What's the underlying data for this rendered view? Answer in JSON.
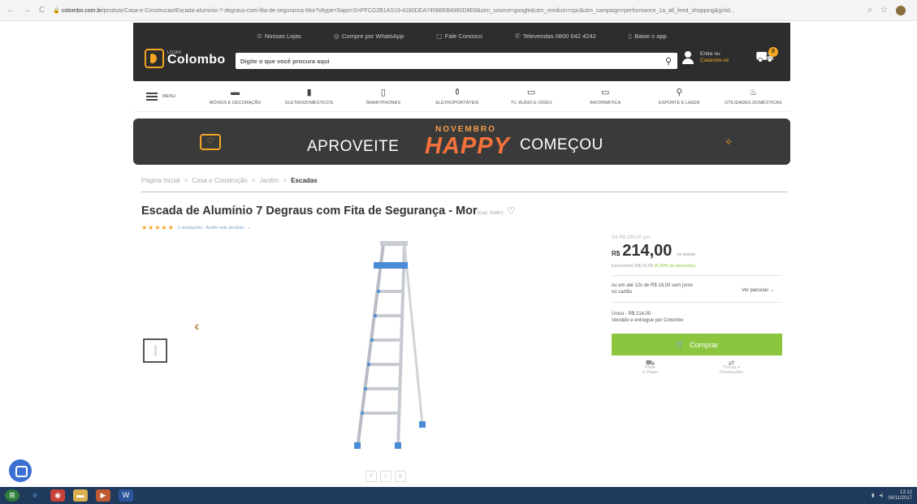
{
  "browser": {
    "url_host": "colombo.com.br",
    "url_path": "/produto/Casa-e-Construcao/Escada-aluminio-7-degraus-com-fita-de-seguranca-Mor?sltype=Sapo=S=PFCG2B1AS19-4180DEA74588EB4980D8E8&utm_source=google&utm_medium=cpc&utm_campaign=performance_1a_all_feed_shopping&gclid..."
  },
  "header": {
    "links": [
      {
        "icon": "pin-icon",
        "label": "Nossas Lojas"
      },
      {
        "icon": "whatsapp-icon",
        "label": "Compre por WhatsApp"
      },
      {
        "icon": "chat-icon",
        "label": "Fale Conosco"
      },
      {
        "icon": "phone-icon",
        "label": "Televendas 0800 642 4242"
      },
      {
        "icon": "mobile-icon",
        "label": "Baixe o app"
      }
    ],
    "logo_small": "LOJAS",
    "logo": "Colombo",
    "search_placeholder": "Digite o que você procura aqui",
    "login_line1": "Entre ou",
    "login_line2": "Cadastre-se",
    "cart_count": "0"
  },
  "nav": {
    "menu_label": "MENU",
    "categories": [
      {
        "icon": "sofa-icon",
        "label": "MÓVEIS E DECORAÇÃO"
      },
      {
        "icon": "fridge-icon",
        "label": "ELETRODOMÉSTICOS"
      },
      {
        "icon": "smartphone-icon",
        "label": "SMARTPHONES"
      },
      {
        "icon": "blender-icon",
        "label": "ELETROPORTÁTEIS"
      },
      {
        "icon": "tv-icon",
        "label": "TV, ÁUDIO E VÍDEO"
      },
      {
        "icon": "laptop-icon",
        "label": "INFORMÁTICA"
      },
      {
        "icon": "bike-icon",
        "label": "ESPORTE E LAZER"
      },
      {
        "icon": "pot-icon",
        "label": "UTILIDADES DOMÉSTICAS"
      }
    ]
  },
  "banner": {
    "left": "APROVEITE",
    "month": "NOVEMBRO",
    "happy": "HAPPY",
    "right": "COMEÇOU"
  },
  "breadcrumb": [
    "Página Inicial",
    "Casa e Construção",
    "Jardim",
    "Escadas"
  ],
  "product": {
    "title": "Escada de Alumínio 7 Degraus com Fita de Segurança - Mor",
    "code": "(Cod. 22487)",
    "reviews": "2 avaliações",
    "review_link": "Avalie este produto",
    "rating": 5
  },
  "buybox": {
    "from_price": "De R$ 299,00 por",
    "currency": "R$",
    "price": "214,00",
    "price_note": "no boleto",
    "economy_prefix": "Economize R$ 15,00",
    "economy_pct": "(5,00% de desconto)",
    "installment_line1": "ou em até 12x de R$ 19,00 sem juros",
    "installment_line2": "no cartão",
    "installment_link": "Ver parcelas",
    "seller_line1": "Único - R$ 214,00",
    "seller_line2": "Vendido e entregue por Colombo",
    "buy_label": "Comprar",
    "perk1_line1": "Frete",
    "perk1_line2": "e Prazo",
    "perk2_line1": "Trocas e",
    "perk2_line2": "Devoluções"
  },
  "share": [
    "f",
    "t",
    "p"
  ],
  "taskbar": {
    "time": "13:12",
    "date": "06/11/2017"
  },
  "colors": {
    "header_bg": "#2d2d2d",
    "accent": "#f5a623",
    "buy_green": "#8cc63f",
    "happy_orange": "#f5733a"
  }
}
